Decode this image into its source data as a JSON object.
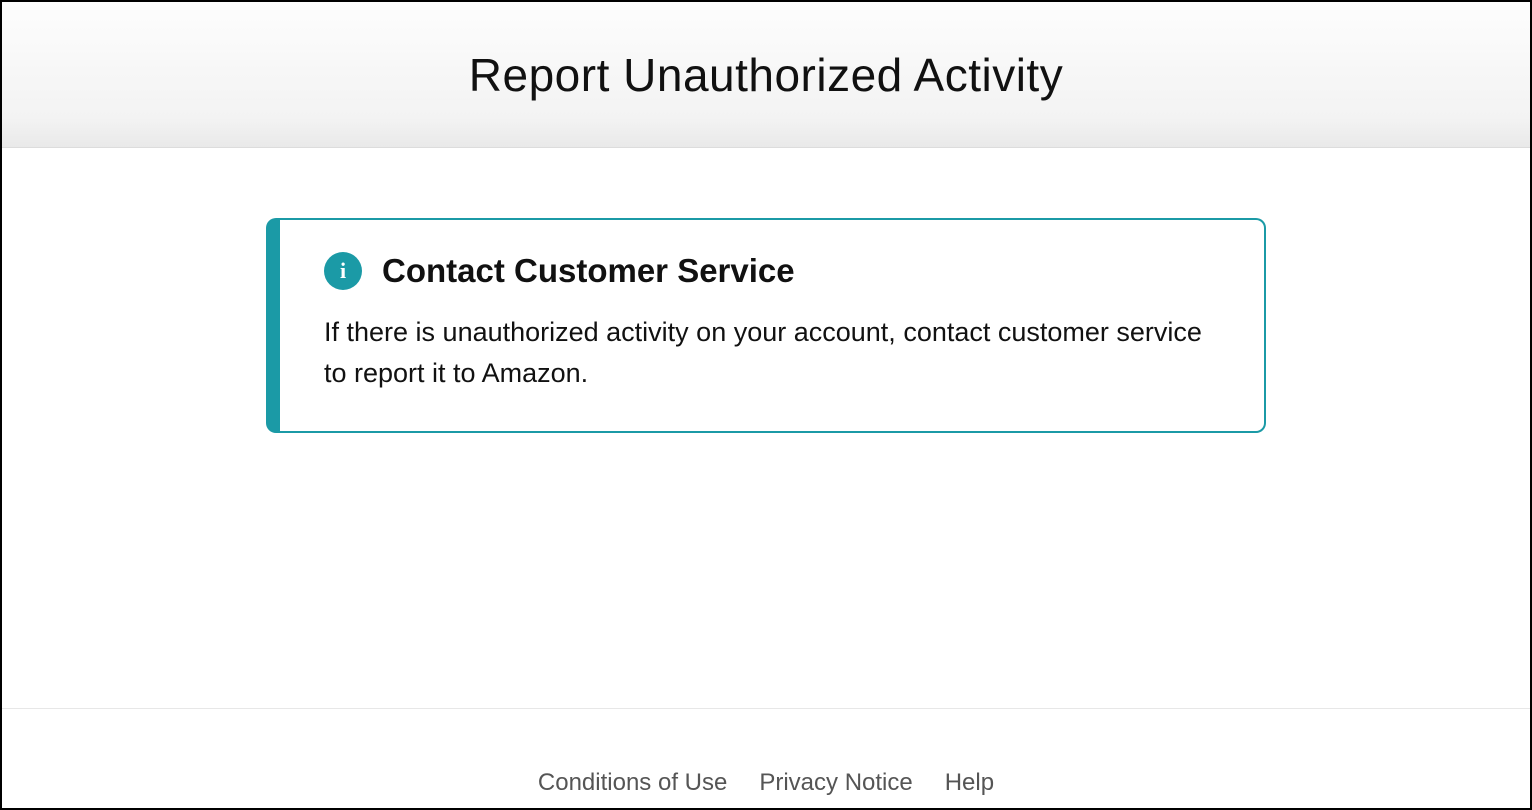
{
  "header": {
    "title": "Report Unauthorized Activity"
  },
  "alert": {
    "icon_name": "info-icon",
    "title": "Contact Customer Service",
    "body": "If there is unauthorized activity on your account, contact customer service to report it to Amazon."
  },
  "footer": {
    "links": [
      {
        "label": "Conditions of Use"
      },
      {
        "label": "Privacy Notice"
      },
      {
        "label": "Help"
      }
    ]
  }
}
